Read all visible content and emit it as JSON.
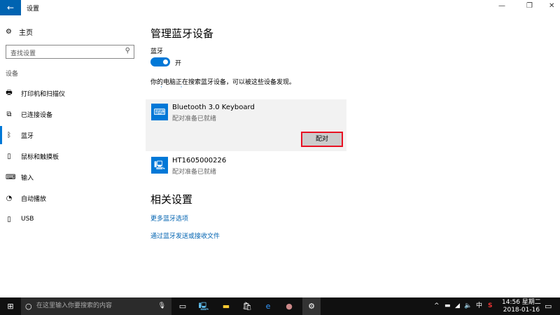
{
  "window": {
    "title": "设置",
    "back_icon": "←",
    "min": "—",
    "max": "❐",
    "close": "✕"
  },
  "sidebar": {
    "home": "主页",
    "search_placeholder": "查找设置",
    "section": "设备",
    "items": [
      {
        "label": "打印机和扫描仪",
        "icon": "🖶"
      },
      {
        "label": "已连接设备",
        "icon": "⧉"
      },
      {
        "label": "蓝牙",
        "icon": "ᛒ"
      },
      {
        "label": "鼠标和触摸板",
        "icon": "▯"
      },
      {
        "label": "输入",
        "icon": "⌨"
      },
      {
        "label": "自动播放",
        "icon": "◔"
      },
      {
        "label": "USB",
        "icon": "▯"
      }
    ]
  },
  "main": {
    "title": "管理蓝牙设备",
    "bt_label": "蓝牙",
    "toggle_state": "开",
    "searching": "你的电脑正在搜索蓝牙设备，可以被这些设备发现。",
    "devices": [
      {
        "name": "Bluetooth 3.0 Keyboard",
        "status": "配对准备已就绪",
        "icon": "⌨"
      },
      {
        "name": "HT1605000226",
        "status": "配对准备已就绪",
        "icon": "🖳"
      }
    ],
    "pair_button": "配对",
    "related_title": "相关设置",
    "links": [
      "更多蓝牙选项",
      "通过蓝牙发送或接收文件"
    ]
  },
  "taskbar": {
    "search_placeholder": "在这里输入你要搜索的内容",
    "time": "14:56 星期二",
    "date": "2018-01-16",
    "ime": "中"
  }
}
